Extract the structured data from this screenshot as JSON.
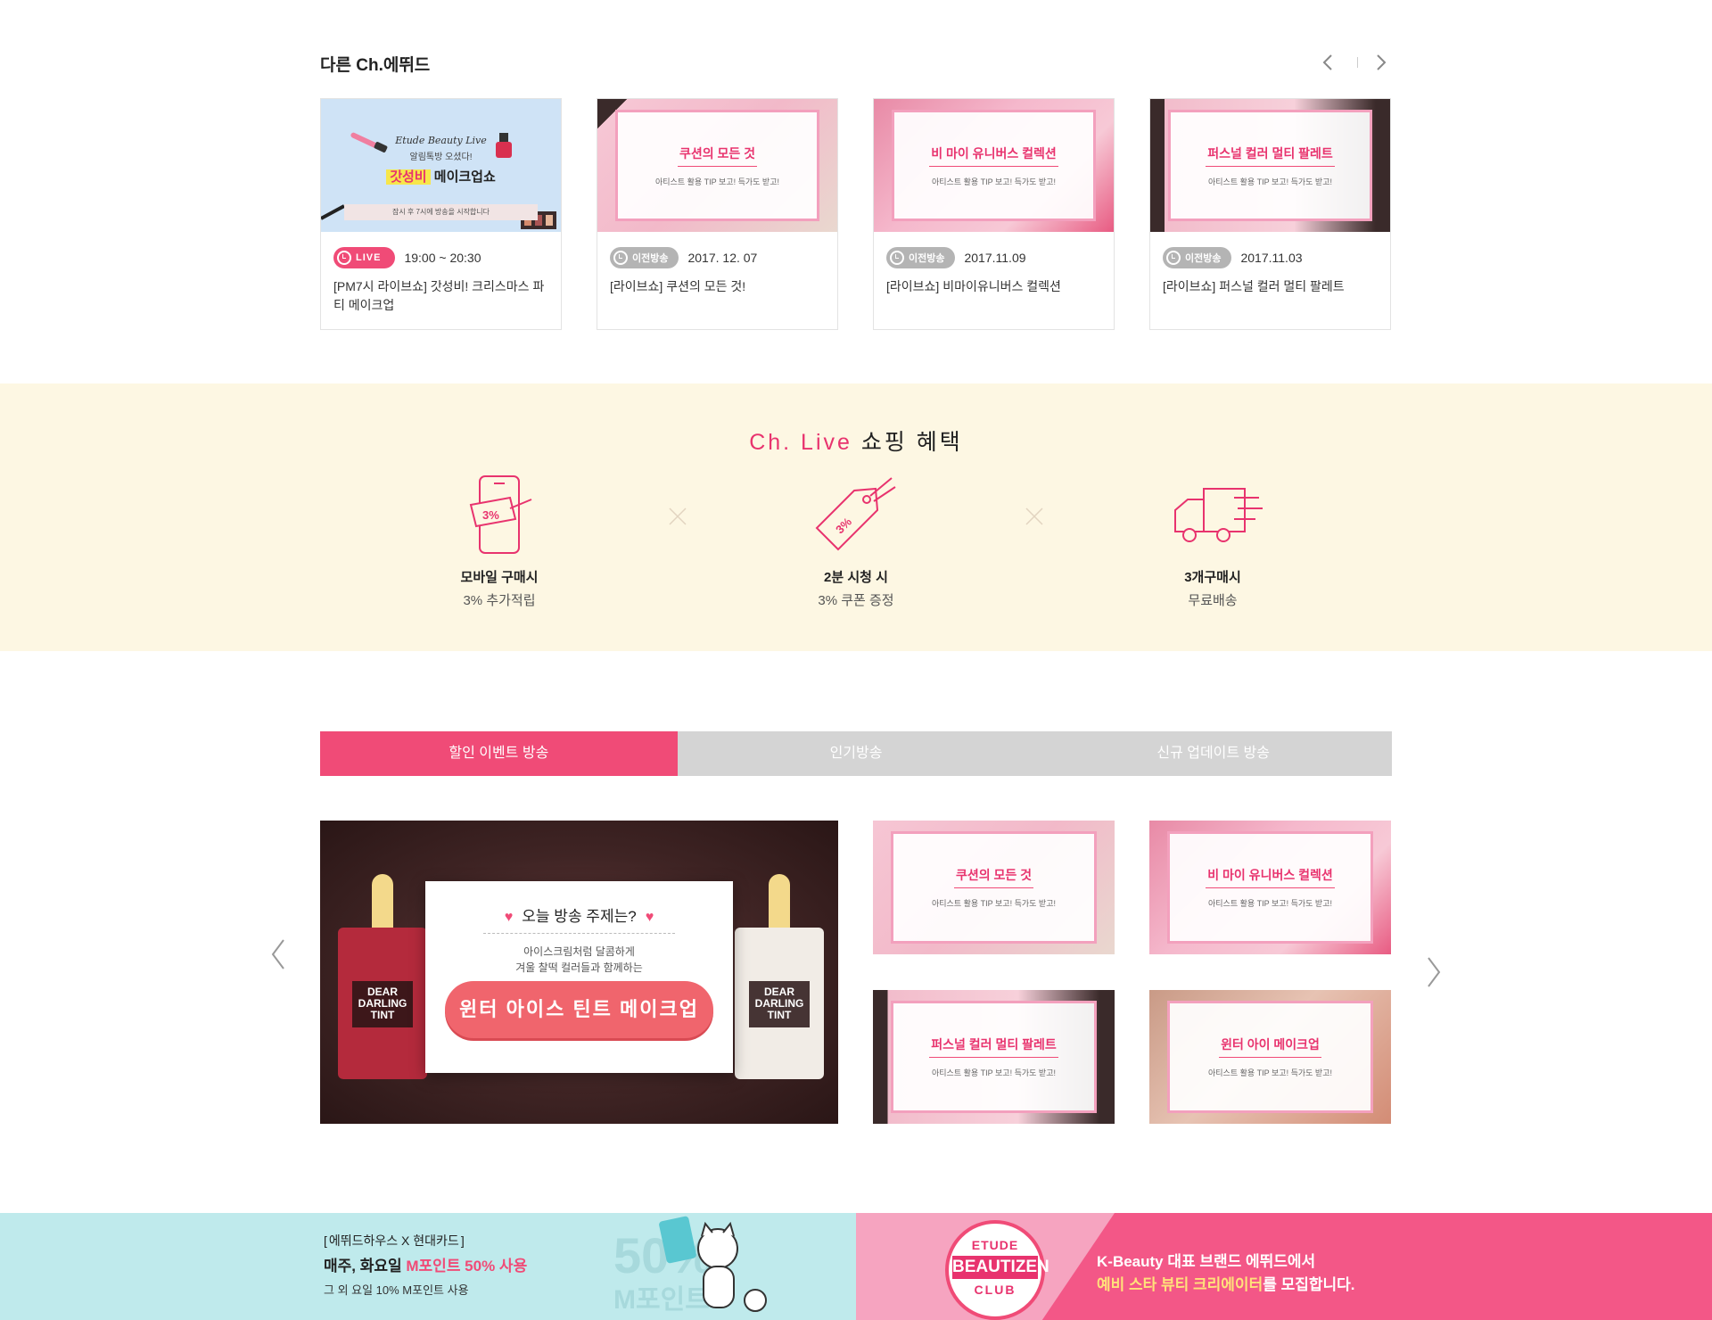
{
  "other_episodes": {
    "title": "다른 Ch.에뛰드",
    "cards": [
      {
        "badge": "LIVE",
        "badge_type": "live",
        "date": "19:00 ~ 20:30",
        "title": "[PM7시 라이브쇼] 갓성비! 크리스마스 파티 메이크업",
        "thumb": {
          "line1": "Etude Beauty Live",
          "line2": "알림톡방 오셨다!",
          "line3_hl": "갓성비",
          "line3": "메이크업쇼",
          "bar": "잠시 후 7시에 방송을 시작합니다"
        }
      },
      {
        "badge": "이전방송",
        "badge_type": "past",
        "date": "2017. 12. 07",
        "title": "[라이브쇼] 쿠션의 모든 것!",
        "thumb": {
          "t1": "쿠션의 모든 것",
          "t2": "아티스트 활용 TIP 보고! 득가도 받고!"
        }
      },
      {
        "badge": "이전방송",
        "badge_type": "past",
        "date": "2017.11.09",
        "title": "[라이브쇼] 비마이유니버스 컬렉션",
        "thumb": {
          "t1": "비 마이 유니버스 컬렉션",
          "t2": "아티스트 활용 TIP 보고! 득가도 받고!"
        }
      },
      {
        "badge": "이전방송",
        "badge_type": "past",
        "date": "2017.11.03",
        "title": "[라이브쇼] 퍼스널 컬러 멀티 팔레트",
        "thumb": {
          "t1": "퍼스널 컬러 멀티 팔레트",
          "t2": "아티스트 활용 TIP 보고! 득가도 받고!"
        }
      }
    ]
  },
  "benefits": {
    "title_pink": "Ch. Live",
    "title_rest": "쇼핑 혜택",
    "items": [
      {
        "icon": "mobile-phone-icon",
        "icon_text": "3%",
        "label": "모바일 구매시",
        "desc": "3% 추가적립"
      },
      {
        "icon": "price-tag-icon",
        "icon_text": "3%",
        "label": "2분 시청 시",
        "desc": "3% 쿠폰 증정"
      },
      {
        "icon": "delivery-truck-icon",
        "label": "3개구매시",
        "desc": "무료배송"
      }
    ]
  },
  "tabs": [
    {
      "label": "할인 이벤트 방송",
      "active": true
    },
    {
      "label": "인기방송",
      "active": false
    },
    {
      "label": "신규 업데이트 방송",
      "active": false
    }
  ],
  "hero": {
    "question": "오늘 방송 주제는?",
    "desc1": "아이스크림처럼 달콤하게",
    "desc2": "겨울 찰떡 컬러들과 함께하는",
    "pill": "윈터 아이스 틴트 메이크업",
    "box_name": "DEAR DARLING TINT"
  },
  "grid": [
    {
      "t1": "쿠션의 모든 것",
      "t2": "아티스트 활용 TIP 보고! 득가도 받고!"
    },
    {
      "t1": "비 마이 유니버스 컬렉션",
      "t2": "아티스트 활용 TIP 보고! 득가도 받고!"
    },
    {
      "t1": "퍼스널 컬러 멀티 팔레트",
      "t2": "아티스트 활용 TIP 보고! 득가도 받고!"
    },
    {
      "t1": "윈터 아이 메이크업",
      "t2": "아티스트 활용 TIP 보고! 득가도 받고!"
    }
  ],
  "banner_left": {
    "line1": "에뛰드하우스 X 현대카드",
    "line2_a": "매주, 화요일 ",
    "line2_pink": "M포인트 50% 사용",
    "line3": "그 외 요일 10% M포인트 사용",
    "big1": "50%",
    "big2": "M포인트"
  },
  "banner_right": {
    "seal_1": "ETUDE",
    "seal_2": "BEAUTIZEN",
    "seal_3": "CLUB",
    "line1": "K-Beauty 대표 브랜드 에뛰드에서",
    "line2_yellow": "예비 스타 뷰티 크리에이터",
    "line2_rest": "를 모집합니다."
  },
  "colors": {
    "accent": "#f04b77",
    "tab_inactive": "#d4d4d4",
    "benefits_bg": "#fdf7e3",
    "banner_left_bg": "#bfeaec",
    "banner_right_bg": "#f35787"
  }
}
